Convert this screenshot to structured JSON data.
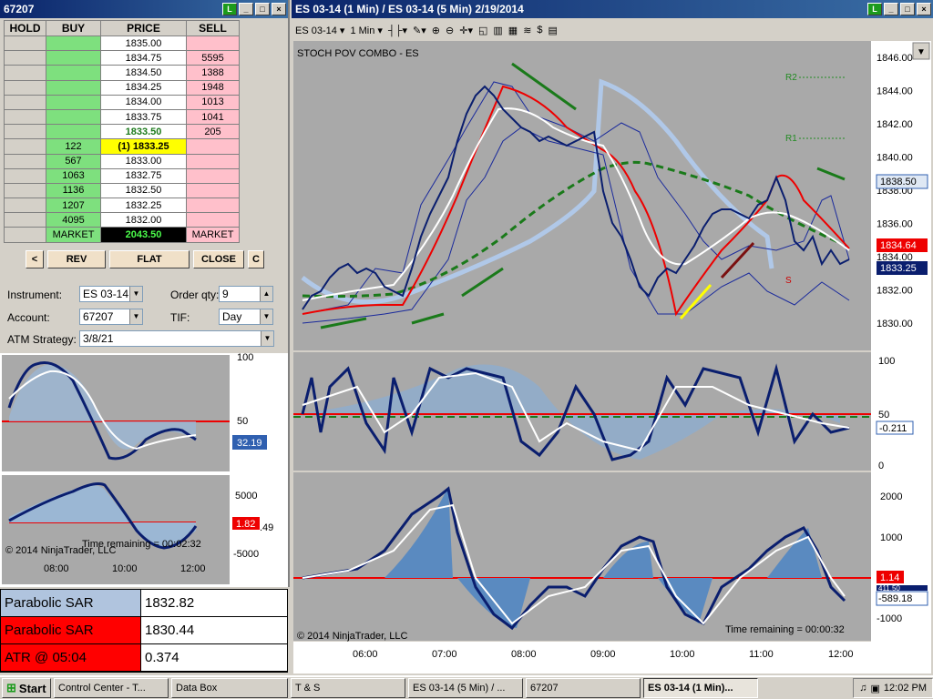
{
  "dom_window": {
    "title": "67207"
  },
  "ladder": {
    "headers": {
      "hold": "HOLD",
      "buy": "BUY",
      "price": "PRICE",
      "sell": "SELL"
    },
    "rows": [
      {
        "buy": "",
        "price": "1835.00",
        "sell": ""
      },
      {
        "buy": "",
        "price": "1834.75",
        "sell": "5595"
      },
      {
        "buy": "",
        "price": "1834.50",
        "sell": "1388"
      },
      {
        "buy": "",
        "price": "1834.25",
        "sell": "1948"
      },
      {
        "buy": "",
        "price": "1834.00",
        "sell": "1013"
      },
      {
        "buy": "",
        "price": "1833.75",
        "sell": "1041"
      },
      {
        "buy": "",
        "price": "1833.50",
        "sell": "205"
      },
      {
        "buy": "122",
        "price": "(1) 1833.25",
        "sell": ""
      },
      {
        "buy": "567",
        "price": "1833.00",
        "sell": ""
      },
      {
        "buy": "1063",
        "price": "1832.75",
        "sell": ""
      },
      {
        "buy": "1136",
        "price": "1832.50",
        "sell": ""
      },
      {
        "buy": "1207",
        "price": "1832.25",
        "sell": ""
      },
      {
        "buy": "4095",
        "price": "1832.00",
        "sell": ""
      }
    ],
    "market_buy": "MARKET",
    "market_price": "2043.50",
    "market_sell": "MARKET"
  },
  "order_buttons": {
    "left": "<",
    "rev": "REV",
    "flat": "FLAT",
    "close": "CLOSE",
    "c": "C"
  },
  "order_form": {
    "instrument_label": "Instrument:",
    "instrument": "ES 03-14",
    "account_label": "Account:",
    "account": "67207",
    "qty_label": "Order qty:",
    "qty": "9",
    "tif_label": "TIF:",
    "tif": "Day",
    "atm_label": "ATM Strategy:",
    "atm": "3/8/21"
  },
  "left_charts": {
    "osc_ticks": [
      "100",
      "50"
    ],
    "osc_value": "32.19",
    "mom_ticks": [
      "5000",
      "-5000"
    ],
    "mom_value": "1.82",
    "mom_value2": ".49",
    "time_remaining": "Time remaining = 00:02:32",
    "copyright": "© 2014 NinjaTrader, LLC",
    "x_ticks": [
      "08:00",
      "10:00",
      "12:00"
    ]
  },
  "sar_table": [
    {
      "label": "Parabolic SAR",
      "value": "1832.82",
      "color": "#b0c4de"
    },
    {
      "label": "Parabolic SAR",
      "value": "1830.44",
      "color": "#ff0000"
    },
    {
      "label": "ATR @ 05:04",
      "value": "0.374",
      "color": "#ff0000"
    }
  ],
  "chart_window": {
    "title": "ES 03-14 (1 Min) / ES 03-14 (5 Min)  2/19/2014",
    "instrument": "ES 03-14",
    "interval": "1 Min",
    "indicator_label": "STOCH POV COMBO - ES",
    "price_ticks": [
      "1846.00",
      "1844.00",
      "1842.00",
      "1840.00",
      "1838.00",
      "1836.00",
      "1834.00",
      "1832.00",
      "1830.00"
    ],
    "price_labels": {
      "blue_top": "1838.50",
      "red": "1834.64",
      "dark": "1833.25"
    },
    "pivot_labels": [
      "R2",
      "R1",
      "S"
    ],
    "osc_ticks": [
      "100",
      "50",
      "0"
    ],
    "osc_value": "-0.211",
    "mom_ticks": [
      "2000",
      "1000",
      "-1000"
    ],
    "mom_red": "1.14",
    "mom_blue": "411.50",
    "mom_white": "-589.18",
    "copyright": "© 2014 NinjaTrader, LLC",
    "time_remaining": "Time remaining = 00:00:32",
    "x_ticks": [
      "06:00",
      "07:00",
      "08:00",
      "09:00",
      "10:00",
      "11:00",
      "12:00"
    ]
  },
  "taskbar": {
    "start": "Start",
    "items": [
      "Control Center - T...",
      "Data Box",
      "T & S",
      "ES 03-14 (5 Min) / ...",
      "67207",
      "ES 03-14 (1 Min)..."
    ],
    "clock": "12:02 PM"
  }
}
